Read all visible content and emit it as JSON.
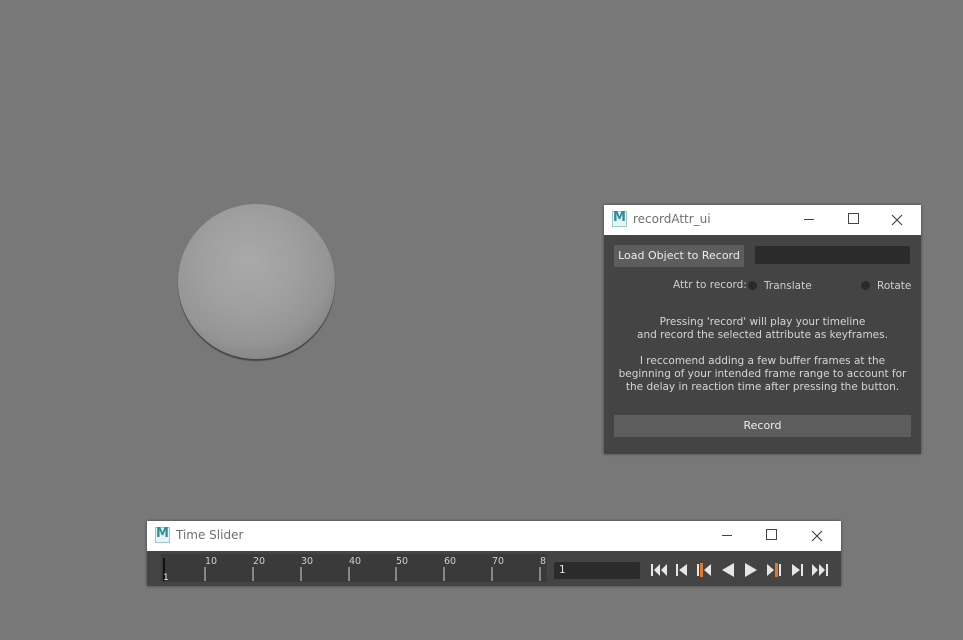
{
  "record_window": {
    "title": "recordAttr_ui",
    "load_button_label": "Load Object to Record",
    "object_field_value": "",
    "attr_label": "Attr to record:",
    "radio_options": [
      "Translate",
      "Rotate"
    ],
    "info_line_1": "Pressing 'record' will play your timeline",
    "info_line_2": "and record the selected attribute as keyframes.",
    "info_line_3": "I reccomend adding a few buffer frames at the",
    "info_line_4": "beginning of your intended frame range to account for",
    "info_line_5": "the delay in reaction time after pressing the button.",
    "record_button_label": "Record"
  },
  "time_slider": {
    "title": "Time Slider",
    "tick_labels": [
      "10",
      "20",
      "30",
      "40",
      "50",
      "60",
      "70",
      "8"
    ],
    "current_frame_marker": "1",
    "current_frame_value": "1",
    "playback_controls": [
      "go-to-start-icon",
      "step-back-icon",
      "prev-key-icon",
      "play-backward-icon",
      "play-forward-icon",
      "next-key-icon",
      "step-forward-icon",
      "go-to-end-icon"
    ]
  },
  "app_logo": "M",
  "colors": {
    "viewport_bg": "#787878",
    "panel_bg": "#444444",
    "button_bg": "#5d5d5d",
    "field_bg": "#2b2b2b",
    "key_marker": "#e07a2a",
    "logo_teal": "#2a8f9a"
  }
}
